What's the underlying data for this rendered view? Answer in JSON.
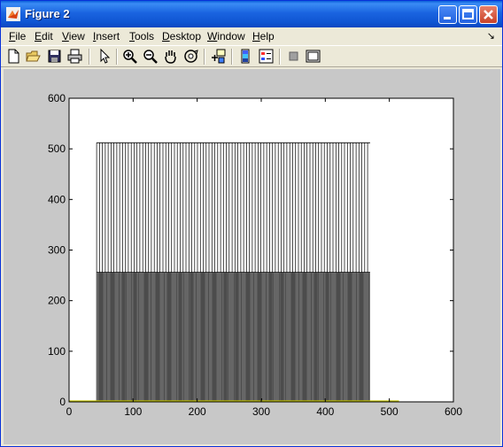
{
  "window": {
    "title": "Figure 2"
  },
  "menu": [
    {
      "label": "File",
      "u": "F",
      "rest": "ile"
    },
    {
      "label": "Edit",
      "u": "E",
      "rest": "dit"
    },
    {
      "label": "View",
      "u": "V",
      "rest": "iew"
    },
    {
      "label": "Insert",
      "u": "I",
      "rest": "nsert"
    },
    {
      "label": "Tools",
      "u": "T",
      "rest": "ools"
    },
    {
      "label": "Desktop",
      "u": "D",
      "rest": "esktop"
    },
    {
      "label": "Window",
      "u": "W",
      "rest": "indow"
    },
    {
      "label": "Help",
      "u": "H",
      "rest": "elp"
    }
  ],
  "toolbar": {
    "tools": [
      "new-file-icon",
      "open-folder-icon",
      "save-icon",
      "print-icon",
      "pointer-icon",
      "zoom-in-icon",
      "zoom-out-icon",
      "pan-hand-icon",
      "rotate-3d-icon",
      "data-cursor-icon",
      "colorbar-icon",
      "legend-icon",
      "hide-plot-tools-icon",
      "show-plot-tools-icon"
    ]
  },
  "colors": {
    "titlebar": "#1a64e0",
    "figure_bg": "#c8c8c8",
    "bars": "#000000",
    "baseline_noise": "#c8c800"
  },
  "chart_data": {
    "type": "bar",
    "title": "",
    "xlabel": "",
    "ylabel": "",
    "xlim": [
      0,
      600
    ],
    "ylim": [
      0,
      600
    ],
    "xticks": [
      0,
      100,
      200,
      300,
      400,
      500,
      600
    ],
    "yticks": [
      0,
      100,
      200,
      300,
      400,
      500,
      600
    ],
    "grid": false,
    "series": [
      {
        "x_start": 43,
        "x_end": 470,
        "values_pattern": [
          512,
          256,
          256
        ],
        "description_values": [
          512,
          256
        ]
      }
    ]
  }
}
